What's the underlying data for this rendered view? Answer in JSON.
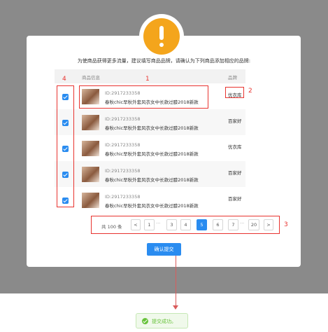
{
  "notice_text": "为使商品获得更多流量，建议填写商品品牌，请确认为下列商品添加相应的品牌:",
  "table": {
    "col_product": "商品信息",
    "col_brand": "品牌",
    "rows": [
      {
        "id": "ID:2917233358",
        "name": "春秋chic早秋外套风衣女中长款过膝2018新款",
        "brand": "优衣库",
        "checked": true
      },
      {
        "id": "ID:2917233358",
        "name": "春秋chic早秋外套风衣女中长款过膝2018新款",
        "brand": "百家好",
        "checked": true
      },
      {
        "id": "ID:2917233358",
        "name": "春秋chic早秋外套风衣女中长款过膝2018新款",
        "brand": "优衣库",
        "checked": true
      },
      {
        "id": "ID:2917233358",
        "name": "春秋chic早秋外套风衣女中长款过膝2018新款",
        "brand": "百家好",
        "checked": true
      },
      {
        "id": "ID:2917233358",
        "name": "春秋chic早秋外套风衣女中长款过膝2018新款",
        "brand": "百家好",
        "checked": true
      }
    ]
  },
  "pagination": {
    "total": "共 100 条",
    "prev": "<",
    "next": ">",
    "ellipsis": "···",
    "pages": [
      "1",
      "3",
      "4",
      "5",
      "6",
      "7",
      "20"
    ],
    "current": "5"
  },
  "annotations": {
    "label1": "1",
    "label2": "2",
    "label3": "3",
    "label4": "4"
  },
  "submit_label": "确认提交",
  "toast_text": "提交成功。",
  "colors": {
    "accent": "#2a8cf0",
    "warning": "#f4a51c",
    "annotation": "#e8332f",
    "success": "#67c23a",
    "overlay": "#8a8a8a"
  },
  "icons": {
    "alert": "exclamation-icon",
    "checkbox": "checkbox-checked-icon",
    "toast": "success-check-icon"
  }
}
